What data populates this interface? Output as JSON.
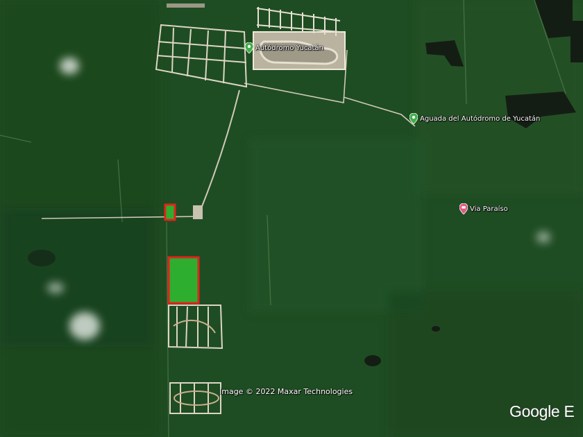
{
  "map": {
    "imagery": "satellite",
    "colors": {
      "vegetation": "#1f4d23",
      "clearing": "#d8d2c0",
      "parcel_outline": "#e0241d",
      "parcel_fill": "#2eae2e",
      "poi_green": "#3fae4a",
      "poi_pink": "#e05a80"
    }
  },
  "pois": [
    {
      "label": "Autódromo Yucatán",
      "icon": "green-pin-icon"
    },
    {
      "label": "Aguada del Autódromo de Yucatán",
      "icon": "green-pin-icon"
    },
    {
      "label": "Via Paraíso",
      "icon": "pink-pin-icon"
    }
  ],
  "attribution": "Image © 2022 Maxar Technologies",
  "logo": "Google E"
}
